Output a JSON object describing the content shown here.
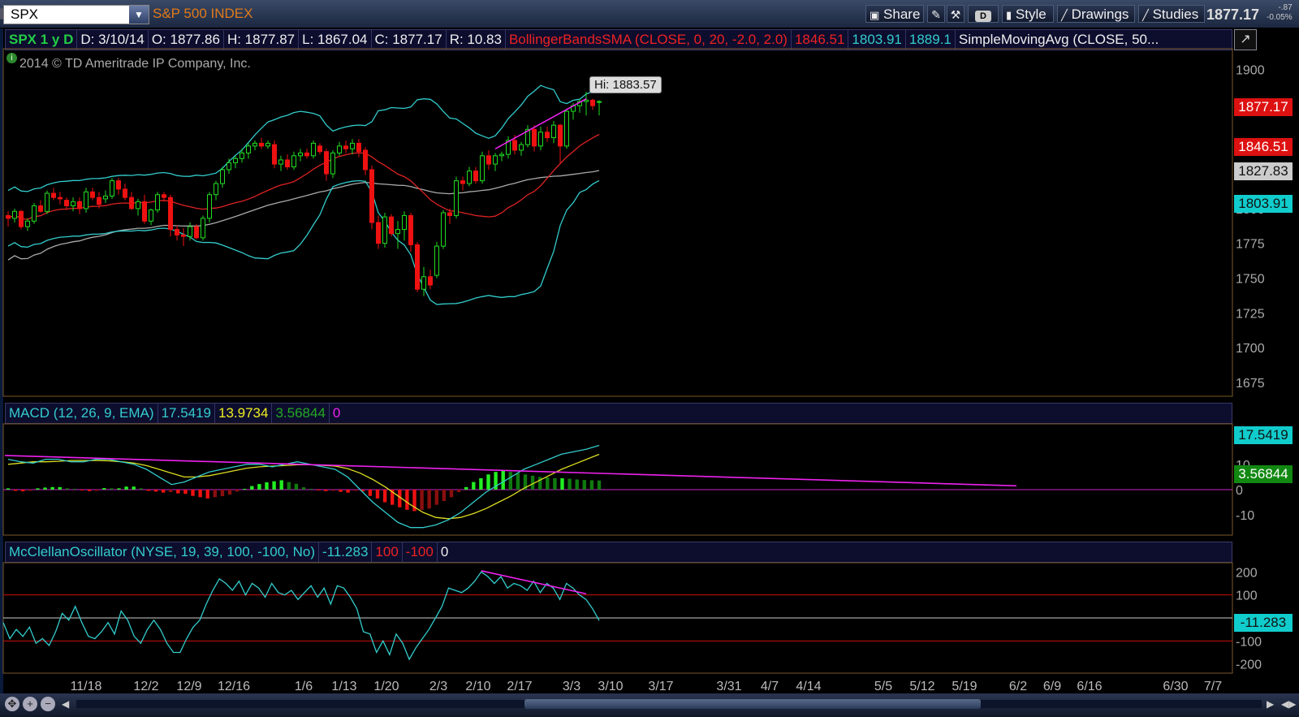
{
  "toolbar": {
    "symbol": "SPX",
    "index_name": "S&P 500 INDEX",
    "share": "Share",
    "d_label": "D",
    "style": "Style",
    "drawings": "Drawings",
    "studies": "Studies",
    "last_price": "1877.17",
    "change": "-.87",
    "change_pct": "-0.05%"
  },
  "price_header": {
    "symbol_period": "SPX 1 y D",
    "date": "D: 3/10/14",
    "open": "O: 1877.86",
    "high": "H: 1877.87",
    "low": "L: 1867.04",
    "close": "C: 1877.17",
    "range": "R: 10.83",
    "bb_label": "BollingerBandsSMA (CLOSE, 0, 20, -2.0, 2.0)",
    "bb_mid": "1846.51",
    "bb_low": "1803.91",
    "bb_up": "1889.1",
    "sma_label": "SimpleMovingAvg (CLOSE, 50..."
  },
  "copyright": "2014 © TD Ameritrade IP Company, Inc.",
  "hi_label": "Hi: 1883.57",
  "price_badges": {
    "last": "1877.17",
    "bb_mid": "1846.51",
    "sma": "1827.83",
    "bb_low": "1803.91"
  },
  "macd_header": {
    "label": "MACD (12, 26, 9, EMA)",
    "value": "17.5419",
    "avg": "13.9734",
    "diff": "3.56844",
    "zero": "0"
  },
  "macd_badges": {
    "value": "17.5419",
    "diff": "3.56844"
  },
  "mcc_header": {
    "label": "McClellanOscillator (NYSE, 19, 39, 100, -100, No)",
    "value": "-11.283",
    "ob": "100",
    "os": "-100",
    "zero": "0"
  },
  "mcc_badges": {
    "value": "-11.283"
  },
  "colors": {
    "up": "#22dd22",
    "down": "#ee1111",
    "bb": "#33cccc",
    "bb_mid": "#dd2222",
    "sma": "#aaaaaa",
    "trend": "#ee22ee",
    "macd": "#33cccc",
    "macd_avg": "#dddd22",
    "zero_line": "#cc22cc"
  },
  "chart_data": [
    {
      "type": "candlestick",
      "y_ticks": [
        1675,
        1700,
        1725,
        1750,
        1775,
        1800,
        1900
      ],
      "ylim": [
        1665,
        1915
      ],
      "x_tick_labels": [
        "11/18",
        "12/2",
        "12/9",
        "12/16",
        "1/6",
        "1/13",
        "1/20",
        "2/3",
        "2/10",
        "2/17",
        "3/3",
        "3/10",
        "3/17",
        "3/31",
        "4/7",
        "4/14",
        "5/5",
        "5/12",
        "5/19",
        "6/2",
        "6/9",
        "6/16",
        "6/30",
        "7/7"
      ],
      "candles": [
        [
          1795,
          1798,
          1787,
          1793
        ],
        [
          1793,
          1800,
          1790,
          1798
        ],
        [
          1798,
          1799,
          1785,
          1787
        ],
        [
          1787,
          1793,
          1784,
          1791
        ],
        [
          1791,
          1804,
          1789,
          1802
        ],
        [
          1802,
          1806,
          1797,
          1798
        ],
        [
          1798,
          1813,
          1796,
          1811
        ],
        [
          1811,
          1815,
          1806,
          1808
        ],
        [
          1808,
          1812,
          1803,
          1807
        ],
        [
          1806,
          1808,
          1799,
          1802
        ],
        [
          1802,
          1808,
          1798,
          1805
        ],
        [
          1805,
          1808,
          1796,
          1800
        ],
        [
          1800,
          1815,
          1797,
          1812
        ],
        [
          1812,
          1815,
          1806,
          1808
        ],
        [
          1808,
          1812,
          1800,
          1803
        ],
        [
          1807,
          1813,
          1804,
          1809
        ],
        [
          1809,
          1822,
          1807,
          1820
        ],
        [
          1820,
          1822,
          1810,
          1814
        ],
        [
          1814,
          1818,
          1806,
          1808
        ],
        [
          1808,
          1812,
          1799,
          1800
        ],
        [
          1800,
          1807,
          1795,
          1805
        ],
        [
          1805,
          1810,
          1789,
          1791
        ],
        [
          1791,
          1800,
          1788,
          1799
        ],
        [
          1799,
          1812,
          1797,
          1810
        ],
        [
          1810,
          1812,
          1805,
          1808
        ],
        [
          1808,
          1810,
          1780,
          1785
        ],
        [
          1785,
          1788,
          1777,
          1781
        ],
        [
          1781,
          1786,
          1773,
          1780
        ],
        [
          1780,
          1790,
          1777,
          1787
        ],
        [
          1787,
          1789,
          1778,
          1779
        ],
        [
          1779,
          1795,
          1777,
          1793
        ],
        [
          1793,
          1812,
          1790,
          1810
        ],
        [
          1810,
          1820,
          1806,
          1818
        ],
        [
          1818,
          1830,
          1815,
          1828
        ],
        [
          1828,
          1836,
          1825,
          1833
        ],
        [
          1833,
          1838,
          1829,
          1836
        ],
        [
          1836,
          1843,
          1833,
          1840
        ],
        [
          1840,
          1847,
          1836,
          1845
        ],
        [
          1845,
          1849,
          1842,
          1847
        ],
        [
          1847,
          1851,
          1843,
          1845
        ],
        [
          1845,
          1849,
          1843,
          1847
        ],
        [
          1846,
          1849,
          1829,
          1832
        ],
        [
          1832,
          1838,
          1827,
          1835
        ],
        [
          1835,
          1839,
          1828,
          1830
        ],
        [
          1830,
          1841,
          1828,
          1838
        ],
        [
          1838,
          1843,
          1834,
          1840
        ],
        [
          1840,
          1843,
          1836,
          1838
        ],
        [
          1838,
          1849,
          1836,
          1847
        ],
        [
          1845,
          1847,
          1839,
          1841
        ],
        [
          1841,
          1843,
          1820,
          1825
        ],
        [
          1825,
          1842,
          1822,
          1840
        ],
        [
          1840,
          1848,
          1838,
          1845
        ],
        [
          1845,
          1849,
          1840,
          1843
        ],
        [
          1843,
          1850,
          1839,
          1847
        ],
        [
          1847,
          1850,
          1837,
          1841
        ],
        [
          1842,
          1844,
          1824,
          1828
        ],
        [
          1828,
          1831,
          1785,
          1790
        ],
        [
          1790,
          1795,
          1771,
          1775
        ],
        [
          1775,
          1797,
          1772,
          1794
        ],
        [
          1794,
          1796,
          1780,
          1782
        ],
        [
          1782,
          1791,
          1771,
          1785
        ],
        [
          1785,
          1798,
          1777,
          1795
        ],
        [
          1795,
          1797,
          1769,
          1774
        ],
        [
          1774,
          1776,
          1740,
          1742
        ],
        [
          1742,
          1758,
          1737,
          1751
        ],
        [
          1751,
          1756,
          1742,
          1745
        ],
        [
          1752,
          1776,
          1750,
          1773
        ],
        [
          1773,
          1799,
          1771,
          1797
        ],
        [
          1797,
          1800,
          1789,
          1795
        ],
        [
          1795,
          1823,
          1793,
          1820
        ],
        [
          1820,
          1823,
          1813,
          1818
        ],
        [
          1818,
          1830,
          1816,
          1827
        ],
        [
          1827,
          1830,
          1818,
          1820
        ],
        [
          1820,
          1841,
          1818,
          1838
        ],
        [
          1838,
          1842,
          1828,
          1832
        ],
        [
          1832,
          1840,
          1827,
          1838
        ],
        [
          1838,
          1841,
          1834,
          1839
        ],
        [
          1839,
          1852,
          1836,
          1849
        ],
        [
          1849,
          1853,
          1839,
          1842
        ],
        [
          1842,
          1848,
          1838,
          1846
        ],
        [
          1846,
          1860,
          1844,
          1857
        ],
        [
          1857,
          1860,
          1841,
          1845
        ],
        [
          1845,
          1859,
          1842,
          1855
        ],
        [
          1855,
          1859,
          1848,
          1851
        ],
        [
          1851,
          1863,
          1847,
          1860
        ],
        [
          1860,
          1861,
          1832,
          1845
        ],
        [
          1845,
          1872,
          1843,
          1870
        ],
        [
          1870,
          1876,
          1864,
          1874
        ],
        [
          1874,
          1879,
          1869,
          1877
        ],
        [
          1877,
          1884,
          1867,
          1878
        ],
        [
          1878,
          1879,
          1871,
          1874
        ],
        [
          1877,
          1878,
          1867,
          1877
        ]
      ],
      "bb_upper_range": [
        1800,
        1889
      ],
      "last_bb_upper": 1889.1,
      "last_bb_mid": 1846.51,
      "last_bb_lower": 1803.91,
      "last_sma": 1827.83,
      "hi": 1883.57
    },
    {
      "type": "bar",
      "name": "MACD",
      "y_ticks": [
        10,
        0,
        -10
      ],
      "macd_last": 17.5419,
      "avg_last": 13.9734,
      "diff_last": 3.56844,
      "diff": [
        0.5,
        -0.5,
        -0.7,
        -0.5,
        0.5,
        0.8,
        1.0,
        1.0,
        0.5,
        0.3,
        -0.3,
        -0.6,
        -0.5,
        0.6,
        0.5,
        0.5,
        1.2,
        1.2,
        0.5,
        -0.5,
        -0.8,
        -1.2,
        -1.0,
        -1.5,
        -1.7,
        -2.5,
        -3.0,
        -3.5,
        -3.0,
        -2.6,
        -2.0,
        -0.8,
        0.3,
        1.4,
        2.2,
        2.9,
        3.3,
        3.7,
        3.0,
        2.3,
        0.9,
        0.3,
        -0.3,
        -0.6,
        -0.5,
        -0.9,
        -1.2,
        -0.5,
        -0.7,
        -2.5,
        -3.5,
        -5.0,
        -6.0,
        -7.0,
        -8.0,
        -8.5,
        -8.0,
        -7.5,
        -6.0,
        -4.5,
        -3.0,
        -1.0,
        1.0,
        3.0,
        4.5,
        6.0,
        7.0,
        7.5,
        7.0,
        6.5,
        6.0,
        5.5,
        5.0,
        4.8,
        4.5,
        4.5,
        4.3,
        4.0,
        3.8,
        3.7,
        3.6
      ]
    },
    {
      "type": "line",
      "name": "McClellanOscillator",
      "y_ticks": [
        200,
        100,
        0,
        -100,
        -200
      ],
      "ylim": [
        -240,
        240
      ],
      "values": [
        -20,
        -90,
        -50,
        -80,
        -40,
        -110,
        -90,
        -120,
        -60,
        20,
        -10,
        50,
        -20,
        -80,
        -90,
        -60,
        -20,
        -70,
        30,
        -10,
        -80,
        -110,
        -50,
        -10,
        -50,
        -110,
        -150,
        -150,
        -90,
        -40,
        -10,
        60,
        120,
        170,
        150,
        120,
        160,
        100,
        150,
        130,
        90,
        150,
        110,
        100,
        120,
        80,
        110,
        140,
        90,
        130,
        60,
        140,
        130,
        90,
        40,
        -60,
        -70,
        -150,
        -100,
        -160,
        -70,
        -110,
        -180,
        -130,
        -90,
        -50,
        0,
        50,
        130,
        120,
        110,
        130,
        160,
        200,
        180,
        150,
        180,
        130,
        150,
        140,
        120,
        160,
        110,
        150,
        130,
        80,
        150,
        130,
        100,
        80,
        40,
        -11.283
      ]
    }
  ]
}
